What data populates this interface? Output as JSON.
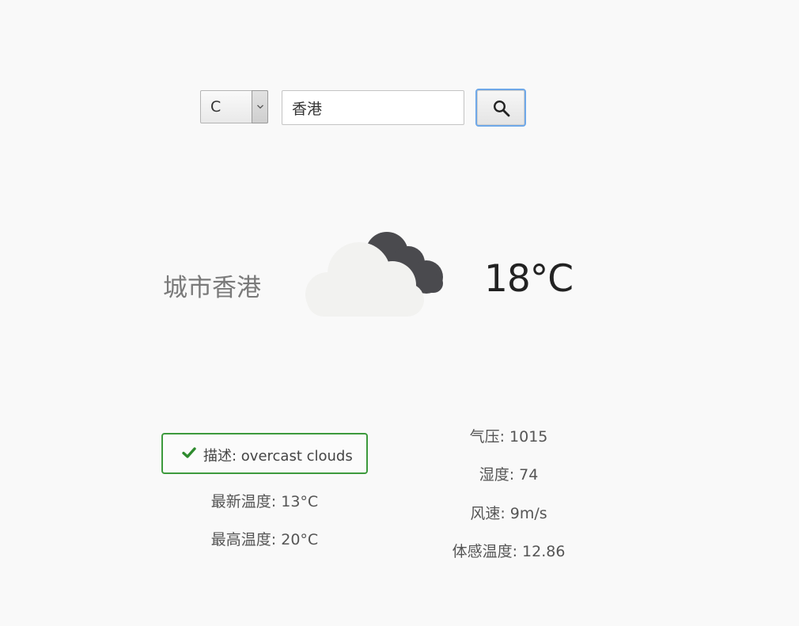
{
  "search": {
    "unit_value": "C",
    "city_value": "香港"
  },
  "weather": {
    "city_label": "城市香港",
    "icon": "cloud-overcast-icon",
    "temperature": "18°C",
    "description": "描述: overcast clouds",
    "min_temp": "最新温度: 13°C",
    "max_temp": "最高温度: 20°C",
    "pressure": "气压: 1015",
    "humidity": "湿度: 74",
    "wind_speed": "风速: 9m/s",
    "feels_like": "体感温度: 12.86"
  },
  "colors": {
    "accent_green": "#3d9a3d",
    "focus_blue": "#6fa8e8",
    "cloud_dark": "#4a4a4e",
    "cloud_light": "#f2f2f0"
  }
}
